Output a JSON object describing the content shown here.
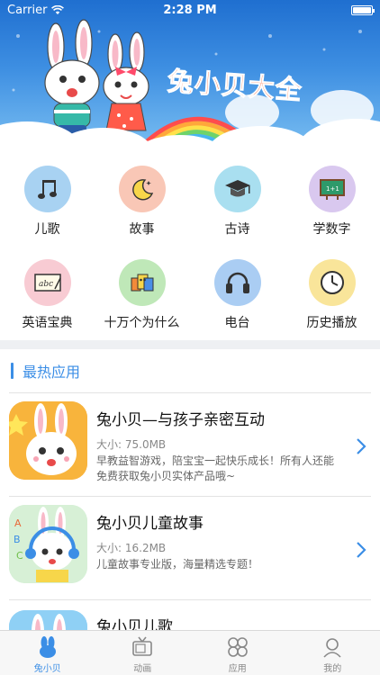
{
  "status_bar": {
    "carrier": "Carrier",
    "time": "2:28 PM"
  },
  "banner": {
    "title": "兔小贝大全"
  },
  "categories": [
    {
      "label": "儿歌",
      "icon": "music-note-icon",
      "color": "#a8d2f2"
    },
    {
      "label": "故事",
      "icon": "moon-icon",
      "color": "#f9c7b6"
    },
    {
      "label": "古诗",
      "icon": "graduation-cap-icon",
      "color": "#a9dff0"
    },
    {
      "label": "学数字",
      "icon": "blackboard-icon",
      "color": "#d9c8ef"
    },
    {
      "label": "英语宝典",
      "icon": "abc-board-icon",
      "color": "#f8cbd3"
    },
    {
      "label": "十万个为什么",
      "icon": "books-icon",
      "color": "#bfe8b8"
    },
    {
      "label": "电台",
      "icon": "headphones-icon",
      "color": "#aacdf3"
    },
    {
      "label": "历史播放",
      "icon": "clock-icon",
      "color": "#f9e59a"
    }
  ],
  "section": {
    "title": "最热应用"
  },
  "apps": [
    {
      "name": "兔小贝—与孩子亲密互动",
      "size": "大小: 75.0MB",
      "desc": "早教益智游戏，陪宝宝一起快乐成长！所有人还能免费获取兔小贝实体产品哦~"
    },
    {
      "name": "兔小贝儿童故事",
      "size": "大小: 16.2MB",
      "desc": "儿童故事专业版，海量精选专题！"
    },
    {
      "name": "兔小贝儿歌",
      "size": "",
      "desc": ""
    }
  ],
  "tabs": [
    {
      "label": "兔小贝",
      "icon": "rabbit-icon",
      "active": true
    },
    {
      "label": "动画",
      "icon": "tv-icon",
      "active": false
    },
    {
      "label": "应用",
      "icon": "apps-grid-icon",
      "active": false
    },
    {
      "label": "我的",
      "icon": "profile-icon",
      "active": false
    }
  ],
  "colors": {
    "accent": "#3b8ee6",
    "banner": "#2f7fd8"
  }
}
